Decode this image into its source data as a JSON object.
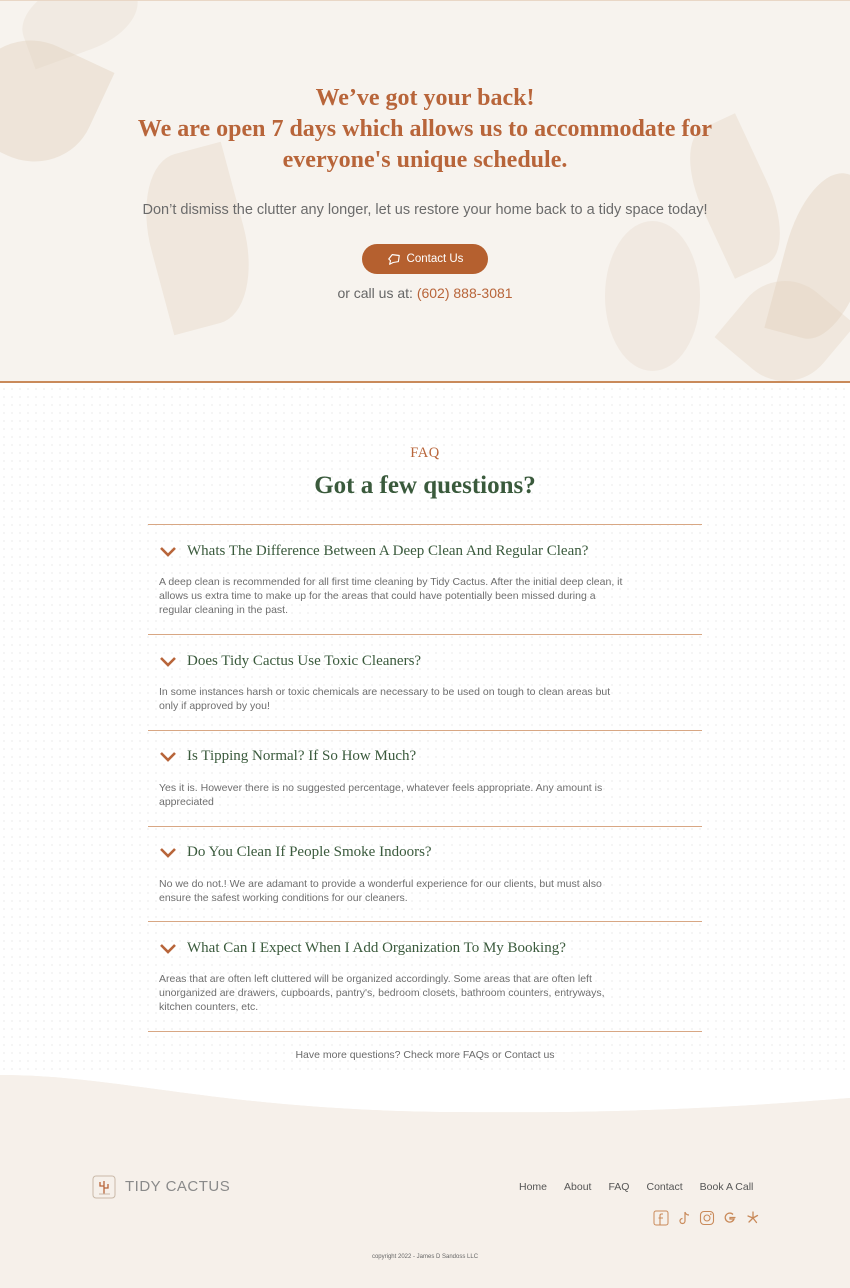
{
  "hero": {
    "title_line1": "We’ve got your back!",
    "title_line2": "We are open 7 days which allows us to accommodate for",
    "title_line3": "everyone's unique schedule.",
    "subtitle": "Don’t dismiss the clutter any longer, let us restore your home back to a tidy space today!",
    "contact_button": "Contact Us",
    "call_prefix": "or call us at: ",
    "phone": "(602) 888-3081"
  },
  "faq": {
    "kicker": "FAQ",
    "heading": "Got a few questions?",
    "items": [
      {
        "question": "Whats The Difference Between A Deep Clean And Regular Clean?",
        "answer_lines": [
          "A deep clean is recommended for all first time cleaning by Tidy Cactus. After the initial deep clean, it",
          "allows us extra time to make up for the areas that could have potentially  been missed during a",
          "regular cleaning in the past."
        ]
      },
      {
        "question": "Does Tidy Cactus Use Toxic Cleaners?",
        "answer_lines": [
          "In some instances harsh or toxic chemicals are necessary to be used on tough to clean areas but",
          "only if approved by you!"
        ]
      },
      {
        "question": "Is Tipping Normal? If So How Much?",
        "answer_lines": [
          "Yes it is. However there is no suggested percentage, whatever feels appropriate. Any amount is",
          "appreciated"
        ]
      },
      {
        "question": "Do You Clean If People Smoke Indoors?",
        "answer_lines": [
          "No we do not.! We are adamant to provide a wonderful experience for our clients, but must also",
          "ensure the safest working conditions for our cleaners."
        ]
      },
      {
        "question": "What Can I Expect When I Add Organization To My Booking?",
        "answer_lines": [
          "Areas that are often left cluttered will be organized accordingly. Some areas that are often left",
          "unorganized are drawers, cupboards, pantry's, bedroom closets, bathroom counters, entryways,",
          "kitchen counters, etc."
        ]
      }
    ],
    "more_text": "Have more questions? Check more FAQs or Contact us"
  },
  "footer": {
    "logo_text": "TIDY CACTUS",
    "nav": [
      "Home",
      "About",
      "FAQ",
      "Contact",
      "Book A Call"
    ],
    "social_icons": [
      "facebook-icon",
      "tiktok-icon",
      "instagram-icon",
      "google-icon",
      "yelp-icon"
    ],
    "copyright": "copyright 2022 - James D Sandoss LLC"
  },
  "colors": {
    "accent": "#b8653a",
    "button": "#b5602f",
    "heading_green": "#3a5a3c",
    "divider": "#d8a784",
    "footer_bg": "#f6f0ea"
  }
}
